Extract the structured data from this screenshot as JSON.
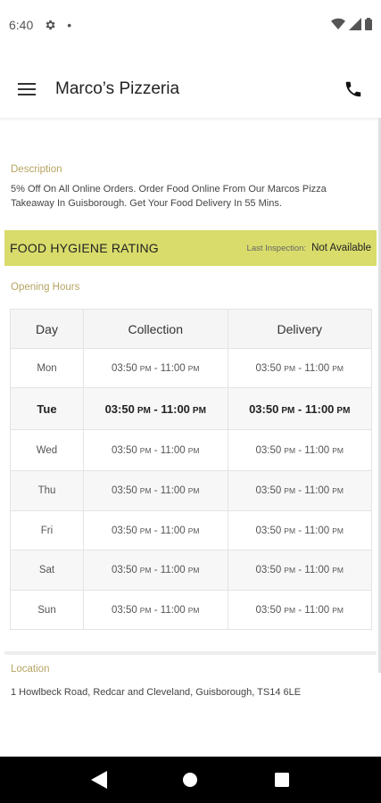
{
  "status_bar": {
    "time": "6:40",
    "dot": "•"
  },
  "app_bar": {
    "title": "Marco’s Pizzeria"
  },
  "description": {
    "label": "Description",
    "text": "5% Off On All Online Orders. Order Food Online From Our Marcos Pizza Takeaway In Guisborough. Get Your Food Delivery In 55 Mins."
  },
  "hygiene": {
    "title": "FOOD HYGIENE RATING",
    "last_inspection_label": "Last Inspection:",
    "last_inspection_value": "Not Available"
  },
  "opening_hours": {
    "label": "Opening Hours",
    "headers": [
      "Day",
      "Collection",
      "Delivery"
    ],
    "rows": [
      {
        "day": "Mon",
        "collection_start": "03:50",
        "collection_start_ampm": "PM",
        "collection_end": "11:00",
        "collection_end_ampm": "PM",
        "delivery_start": "03:50",
        "delivery_start_ampm": "PM",
        "delivery_end": "11:00",
        "delivery_end_ampm": "PM"
      },
      {
        "day": "Tue",
        "collection_start": "03:50",
        "collection_start_ampm": "PM",
        "collection_end": "11:00",
        "collection_end_ampm": "PM",
        "delivery_start": "03:50",
        "delivery_start_ampm": "PM",
        "delivery_end": "11:00",
        "delivery_end_ampm": "PM"
      },
      {
        "day": "Wed",
        "collection_start": "03:50",
        "collection_start_ampm": "PM",
        "collection_end": "11:00",
        "collection_end_ampm": "PM",
        "delivery_start": "03:50",
        "delivery_start_ampm": "PM",
        "delivery_end": "11:00",
        "delivery_end_ampm": "PM"
      },
      {
        "day": "Thu",
        "collection_start": "03:50",
        "collection_start_ampm": "PM",
        "collection_end": "11:00",
        "collection_end_ampm": "PM",
        "delivery_start": "03:50",
        "delivery_start_ampm": "PM",
        "delivery_end": "11:00",
        "delivery_end_ampm": "PM"
      },
      {
        "day": "Fri",
        "collection_start": "03:50",
        "collection_start_ampm": "PM",
        "collection_end": "11:00",
        "collection_end_ampm": "PM",
        "delivery_start": "03:50",
        "delivery_start_ampm": "PM",
        "delivery_end": "11:00",
        "delivery_end_ampm": "PM"
      },
      {
        "day": "Sat",
        "collection_start": "03:50",
        "collection_start_ampm": "PM",
        "collection_end": "11:00",
        "collection_end_ampm": "PM",
        "delivery_start": "03:50",
        "delivery_start_ampm": "PM",
        "delivery_end": "11:00",
        "delivery_end_ampm": "PM"
      },
      {
        "day": "Sun",
        "collection_start": "03:50",
        "collection_start_ampm": "PM",
        "collection_end": "11:00",
        "collection_end_ampm": "PM",
        "delivery_start": "03:50",
        "delivery_start_ampm": "PM",
        "delivery_end": "11:00",
        "delivery_end_ampm": "PM"
      }
    ],
    "highlighted_day": "Tue"
  },
  "location": {
    "label": "Location",
    "address": "1 Howlbeck Road, Redcar and Cleveland, Guisborough, TS14 6LE"
  },
  "icons": {
    "settings": "gear-icon",
    "wifi": "wifi-icon",
    "signal": "signal-icon",
    "battery": "battery-icon",
    "menu": "hamburger-menu-icon",
    "phone": "phone-icon",
    "back": "back-triangle-icon",
    "home": "home-circle-icon",
    "recents": "recents-square-icon"
  },
  "colors": {
    "hygiene_bg": "#d9dc6b",
    "section_label": "#b6a463",
    "nav_bar": "#000000"
  }
}
